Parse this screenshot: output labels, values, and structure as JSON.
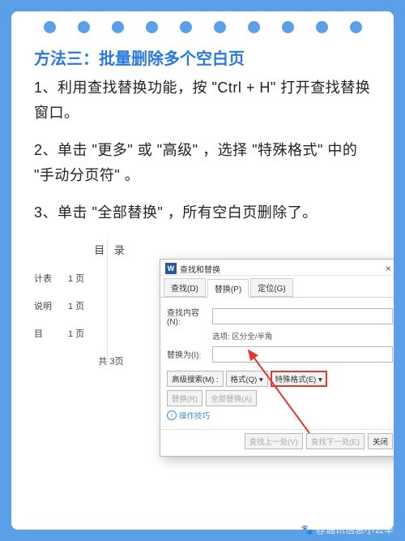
{
  "title": "方法三：批量删除多个空白页",
  "paragraphs": [
    "1、利用查找替换功能，按 \"Ctrl + H\" 打开查找替换窗口。",
    "2、单击 \"更多\" 或 \"高级\" ，选择 \"特殊格式\" 中的 \"手动分页符\" 。",
    "3、单击 \"全部替换\" ，所有空白页删除了。"
  ],
  "background_doc": {
    "heading": "目  录",
    "rows": [
      {
        "label": "计表",
        "value": "1 页"
      },
      {
        "label": "说明",
        "value": "1 页"
      },
      {
        "label": "目",
        "value": "1 页"
      }
    ],
    "total": "共  3页"
  },
  "dialog": {
    "window_title": "查找和替换",
    "close": "×",
    "tabs": {
      "find": "查找(D)",
      "replace": "替换(P)",
      "goto": "定位(G)"
    },
    "find_label": "查找内容(N):",
    "find_value": "",
    "options_label": "选项:",
    "options_value": "区分全/半角",
    "replace_label": "替换为(I):",
    "replace_value": "",
    "buttons": {
      "more": "高级搜索(M) :",
      "format": "格式(Q) ▾",
      "special": "特殊格式(E) ▾",
      "replace_one": "替换(R)",
      "replace_all": "全部替换(A)",
      "find_prev": "查找上一处(V)",
      "find_next": "查找下一处(E)",
      "close": "关闭"
    },
    "tips": "操作技巧"
  },
  "watermark": "🐾 @通讯信息小公举"
}
